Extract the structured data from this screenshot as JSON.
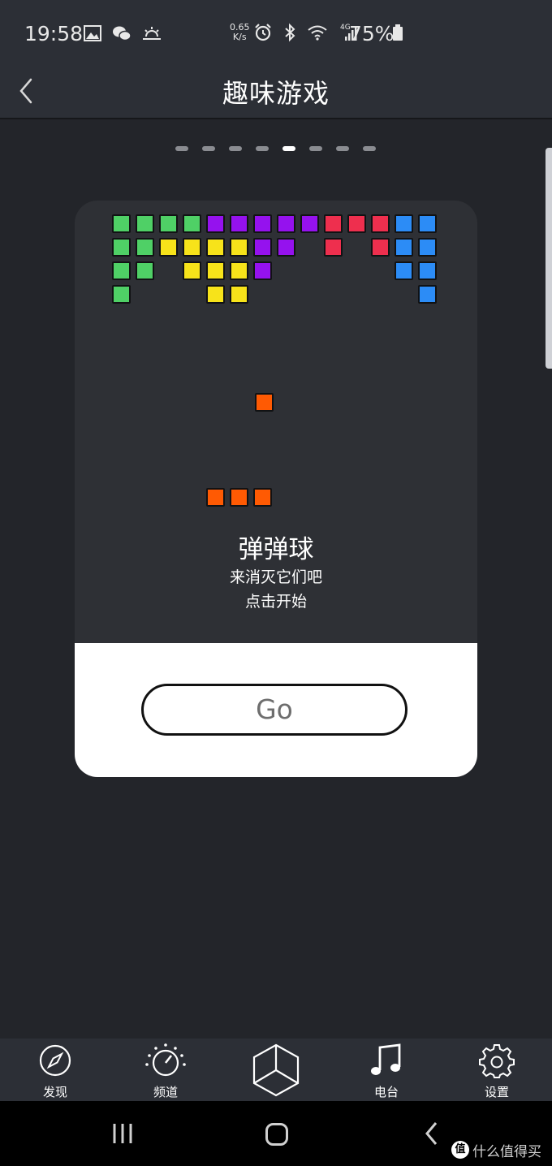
{
  "status_bar": {
    "time": "19:58",
    "net_speed_value": "0.65",
    "net_speed_unit": "K/s",
    "network_type": "4G",
    "battery": "75%"
  },
  "header": {
    "title": "趣味游戏"
  },
  "pager": {
    "total_pages": 8,
    "active_page": 5
  },
  "game": {
    "name": "弹弹球",
    "desc_line1": "来消灭它们吧",
    "desc_line2": "点击开始",
    "go_label": "Go",
    "colors": {
      "green": "#4fd066",
      "purple": "#9512ee",
      "red": "#ee2f4e",
      "blue": "#2c8cf6",
      "yellow": "#f7e31a",
      "orange": "#ff5a03"
    }
  },
  "bottom_nav": {
    "items": [
      {
        "label": "发现",
        "icon": "compass-icon"
      },
      {
        "label": "频道",
        "icon": "dial-icon"
      },
      {
        "label": "",
        "icon": "cube-icon"
      },
      {
        "label": "电台",
        "icon": "music-note-icon"
      },
      {
        "label": "设置",
        "icon": "gear-icon"
      }
    ]
  },
  "watermark": {
    "logo": "值",
    "text": "什么值得买"
  }
}
